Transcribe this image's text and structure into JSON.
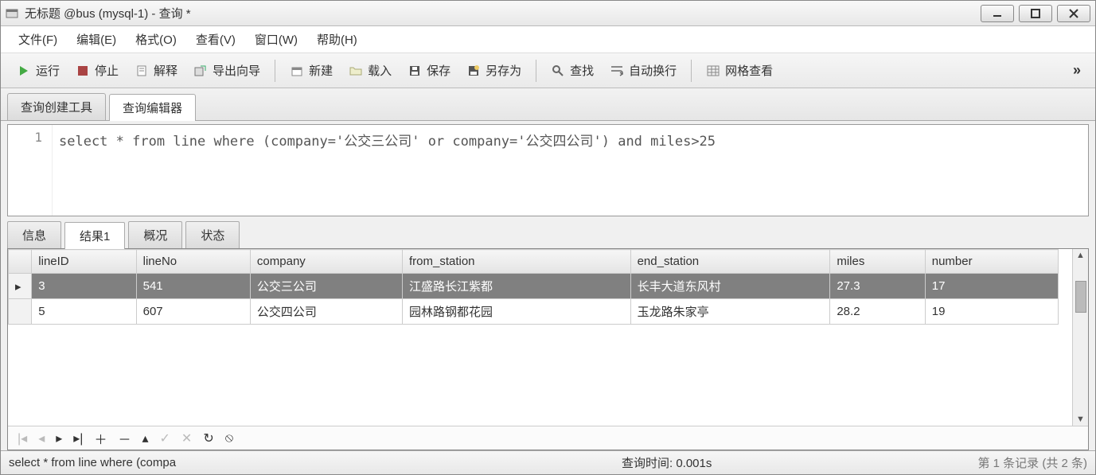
{
  "window": {
    "title": "无标题 @bus (mysql-1) - 查询 *"
  },
  "menu": {
    "file": "文件(F)",
    "edit": "编辑(E)",
    "format": "格式(O)",
    "view": "查看(V)",
    "window": "窗口(W)",
    "help": "帮助(H)"
  },
  "toolbar": {
    "run": "运行",
    "stop": "停止",
    "explain": "解释",
    "export_wizard": "导出向导",
    "new": "新建",
    "load": "载入",
    "save": "保存",
    "save_as": "另存为",
    "find": "查找",
    "auto_wrap": "自动换行",
    "grid_view": "网格查看"
  },
  "tabs": {
    "query_builder": "查询创建工具",
    "query_editor": "查询编辑器"
  },
  "editor": {
    "line_number": "1",
    "sql": "select * from line where (company='公交三公司' or company='公交四公司') and miles>25"
  },
  "result_tabs": {
    "info": "信息",
    "result1": "结果1",
    "profile": "概况",
    "status": "状态"
  },
  "grid": {
    "columns": [
      "lineID",
      "lineNo",
      "company",
      "from_station",
      "end_station",
      "miles",
      "number"
    ],
    "rows": [
      {
        "lineID": "3",
        "lineNo": "541",
        "company": "公交三公司",
        "from_station": "江盛路长江紫都",
        "end_station": "长丰大道东风村",
        "miles": "27.3",
        "number": "17",
        "selected": true
      },
      {
        "lineID": "5",
        "lineNo": "607",
        "company": "公交四公司",
        "from_station": "园林路钢都花园",
        "end_station": "玉龙路朱家亭",
        "miles": "28.2",
        "number": "19",
        "selected": false
      }
    ]
  },
  "status": {
    "sql_preview": "select * from line where (compa",
    "query_time": "查询时间: 0.001s",
    "record_info": "第 1 条记录 (共 2 条)"
  }
}
